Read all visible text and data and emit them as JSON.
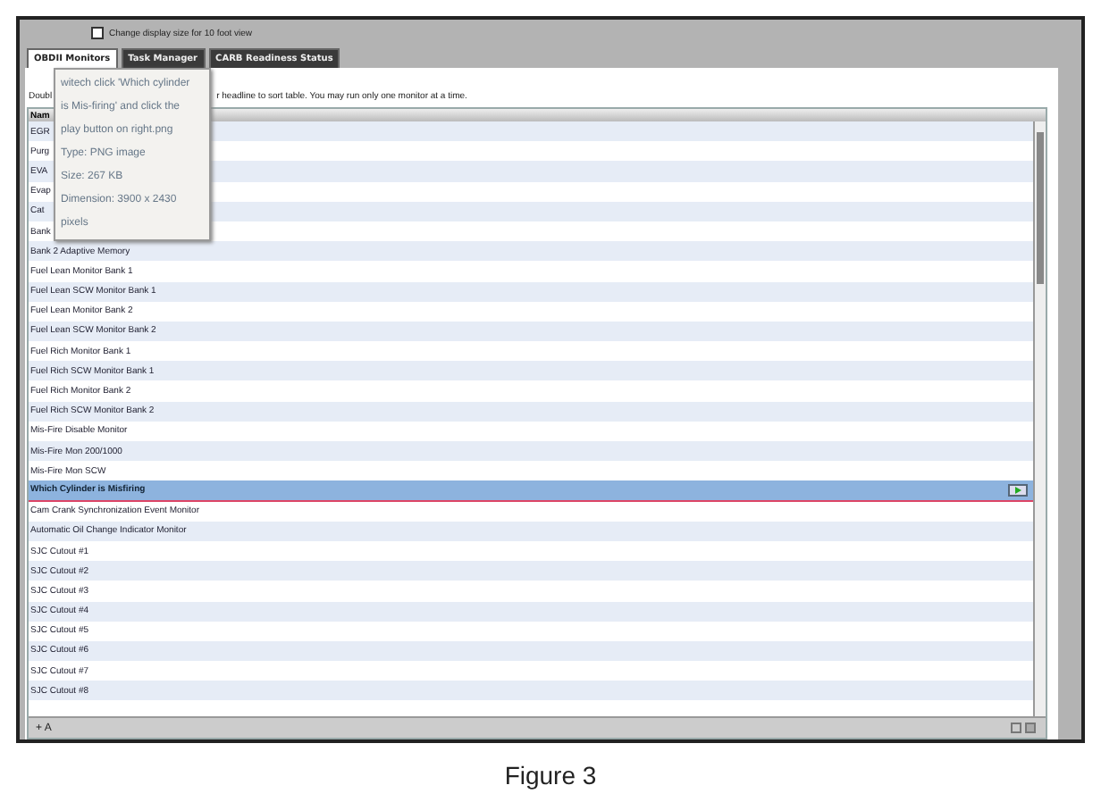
{
  "top_bar": {
    "checkbox": {
      "label": "Change display size for 10 foot view",
      "checked": false
    }
  },
  "tabs": [
    {
      "label": "OBDII Monitors",
      "selected": true
    },
    {
      "label": "Task Manager",
      "selected": false
    },
    {
      "label": "CARB Readiness Status",
      "selected": false
    }
  ],
  "instructions": {
    "before_tooltip": "Doubl",
    "after_tooltip": "r headline to sort table. You may run only one monitor at a time."
  },
  "tooltip": {
    "lines": [
      "witech click 'Which cylinder",
      "is Mis-firing' and click the",
      "play button on right.png",
      "Type: PNG image",
      "Size: 267 KB",
      "Dimension: 3900 x 2430",
      "pixels"
    ]
  },
  "table": {
    "columns": [
      "Nam"
    ],
    "rows": [
      {
        "name": "EGR",
        "selected": false
      },
      {
        "name": "Purg",
        "selected": false
      },
      {
        "name": "EVA",
        "selected": false
      },
      {
        "name": "Evap",
        "selected": false
      },
      {
        "name": "Cat",
        "selected": false
      },
      {
        "name": "Bank",
        "selected": false
      },
      {
        "name": "Bank 2 Adaptive Memory",
        "selected": false
      },
      {
        "name": "Fuel Lean Monitor Bank 1",
        "selected": false
      },
      {
        "name": "Fuel Lean SCW Monitor Bank 1",
        "selected": false
      },
      {
        "name": "Fuel Lean Monitor Bank 2",
        "selected": false
      },
      {
        "name": "Fuel Lean SCW Monitor Bank 2",
        "selected": false
      },
      {
        "name": "Fuel Rich Monitor Bank 1",
        "selected": false
      },
      {
        "name": "Fuel Rich SCW Monitor Bank 1",
        "selected": false
      },
      {
        "name": "Fuel Rich Monitor Bank 2",
        "selected": false
      },
      {
        "name": "Fuel Rich SCW Monitor Bank 2",
        "selected": false
      },
      {
        "name": "Mis-Fire Disable Monitor",
        "selected": false
      },
      {
        "name": "Mis-Fire Mon 200/1000",
        "selected": false
      },
      {
        "name": "Mis-Fire Mon SCW",
        "selected": false
      },
      {
        "name": "Which Cylinder is Misfiring",
        "selected": true
      },
      {
        "name": "Cam Crank Synchronization Event Monitor",
        "selected": false
      },
      {
        "name": "Automatic Oil Change Indicator Monitor",
        "selected": false
      },
      {
        "name": "SJC Cutout #1",
        "selected": false
      },
      {
        "name": "SJC Cutout #2",
        "selected": false
      },
      {
        "name": "SJC Cutout #3",
        "selected": false
      },
      {
        "name": "SJC Cutout #4",
        "selected": false
      },
      {
        "name": "SJC Cutout #5",
        "selected": false
      },
      {
        "name": "SJC Cutout #6",
        "selected": false
      },
      {
        "name": "SJC Cutout #7",
        "selected": false
      },
      {
        "name": "SJC Cutout #8",
        "selected": false
      }
    ]
  },
  "bottom_bar": {
    "left_text": "+ A"
  },
  "caption": "Figure 3"
}
